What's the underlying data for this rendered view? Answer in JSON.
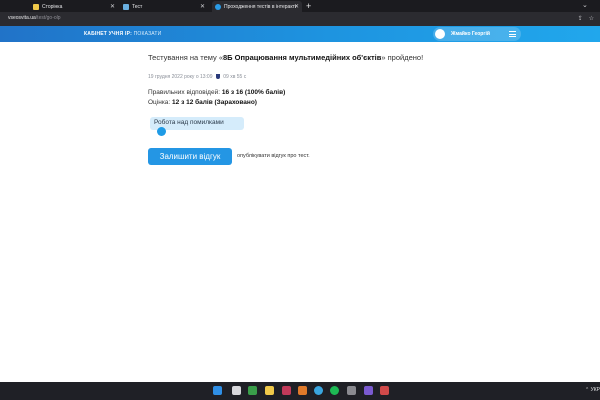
{
  "browser": {
    "tabs": [
      {
        "label": "Сторінка"
      },
      {
        "label": "Тест"
      },
      {
        "label": "Проходження тестів в інтерактивному ..."
      }
    ],
    "url_domain": "vseosvita.ua",
    "url_path": "/test/go-olp"
  },
  "header": {
    "cabinet": "КАБІНЕТ УЧНЯ",
    "ip_label": "IP:",
    "ip_show": "ПОКАЗАТИ",
    "username": "Жмайко Георгій"
  },
  "result": {
    "title_prefix": "Тестування на тему «",
    "title_topic": "8Б Опрацювання мультимедійних об'єктів",
    "title_suffix": "» пройдено!",
    "date": "19 грудня 2022 року о 13:09",
    "duration": "09 хв 55 с",
    "correct_label": "Правильних відповідей:",
    "correct_value": "16 з 16 (100% балів)",
    "grade_label": "Оцінка:",
    "grade_value": "12 з 12 балів (Зараховано)"
  },
  "actions": {
    "mistakes_label": "Робота над помилками",
    "review_label": "Залишити відгук",
    "review_note": "опублікувати відгук про тест."
  },
  "taskbar": {
    "tray_text": "УКР"
  }
}
